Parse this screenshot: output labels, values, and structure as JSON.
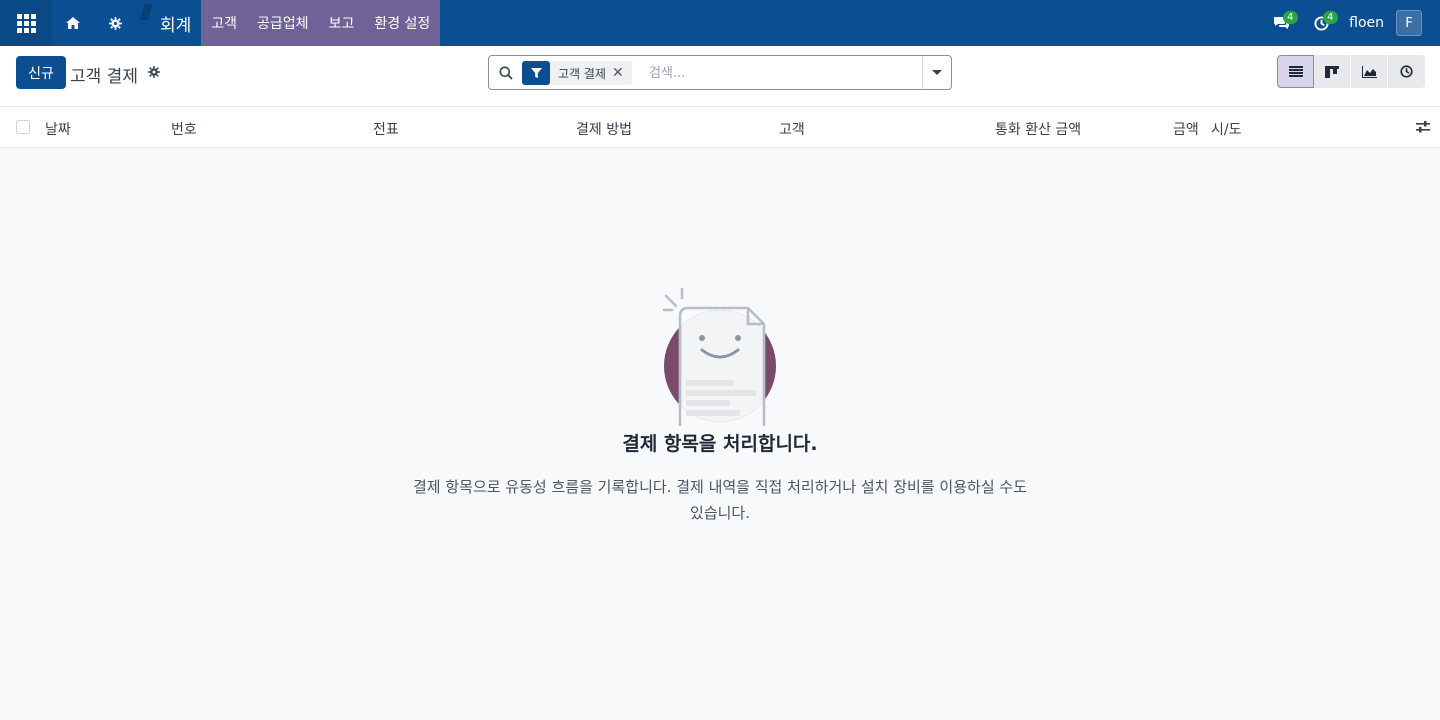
{
  "navbar": {
    "brand": "회계",
    "menu": [
      "고객",
      "공급업체",
      "보고",
      "환경 설정"
    ],
    "messages_badge": "4",
    "activities_badge": "4",
    "username": "floen",
    "avatar_letter": "F"
  },
  "control": {
    "new_button": "신규",
    "title": "고객 결제",
    "search": {
      "facet_label": "고객 결제",
      "placeholder": "검색..."
    }
  },
  "table": {
    "columns": [
      "날짜",
      "번호",
      "전표",
      "결제 방법",
      "고객",
      "통화 환산 금액",
      "금액",
      "시/도"
    ]
  },
  "empty_state": {
    "title": "결제 항목을 처리합니다.",
    "text": "결제 항목으로 유동성 흐름을 기록합니다. 결제 내역을 직접 처리하거나 설치 장비를 이용하실 수도 있습니다."
  },
  "colors": {
    "navbar": "#0b4f92",
    "menu_highlight": "#6e6296",
    "primary": "#0b4f92",
    "illustration_circle": "#7a4a6b"
  },
  "icons": [
    "apps-grid-icon",
    "home-icon",
    "gear-icon",
    "chat-icon",
    "clock-icon",
    "search-icon",
    "filter-icon",
    "list-view-icon",
    "kanban-view-icon",
    "graph-view-icon",
    "activity-view-icon",
    "optional-columns-icon"
  ]
}
